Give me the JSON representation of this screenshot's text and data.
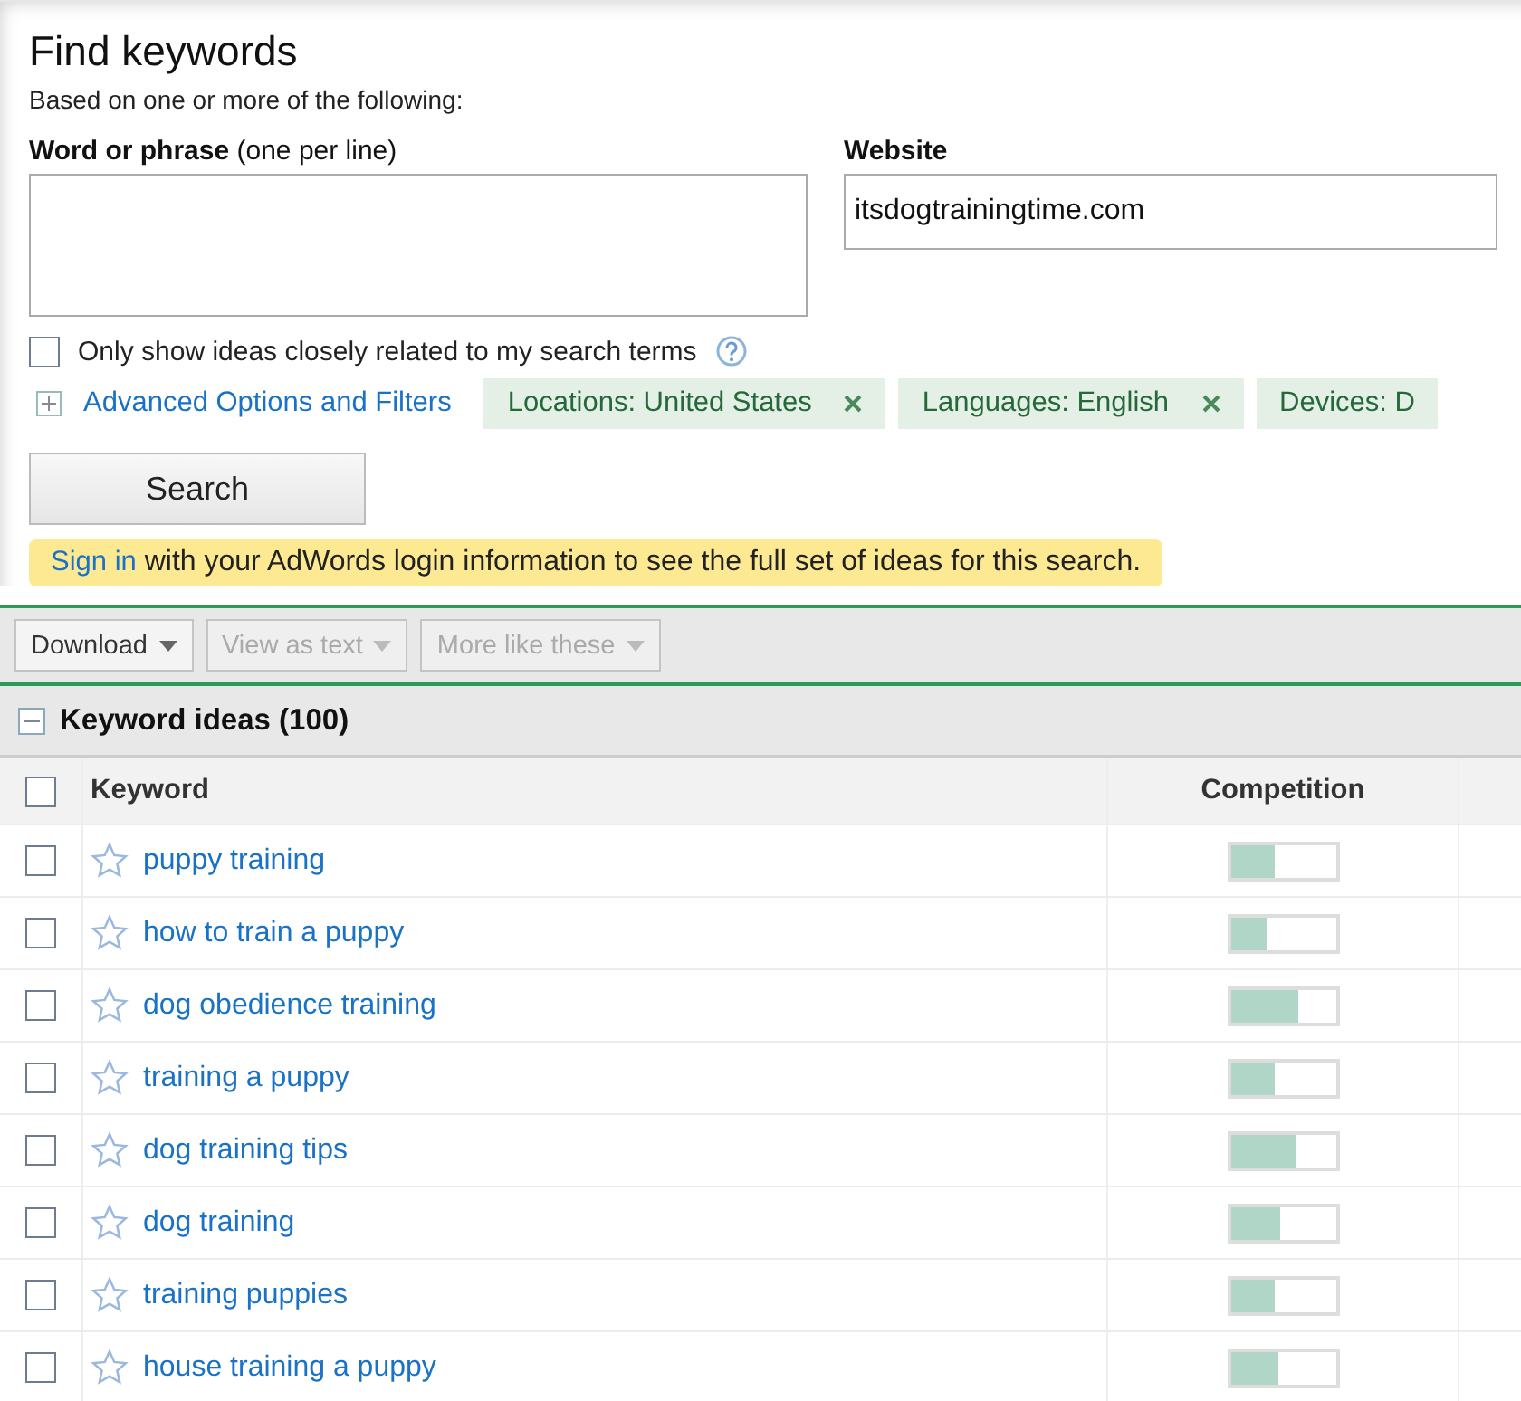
{
  "title": "Find keywords",
  "subtitle": "Based on one or more of the following:",
  "word_field": {
    "label": "Word or phrase",
    "hint": "(one per line)"
  },
  "website_field": {
    "label": "Website",
    "value": "itsdogtrainingtime.com"
  },
  "closely_related": {
    "label": "Only show ideas closely related to my search terms",
    "checked": false
  },
  "advanced_link": "Advanced Options and Filters",
  "filters": [
    {
      "label": "Locations: United States",
      "removable": true
    },
    {
      "label": "Languages: English",
      "removable": true
    },
    {
      "label": "Devices: D",
      "removable": false
    }
  ],
  "search_button": "Search",
  "notice": {
    "link": "Sign in",
    "text": " with your AdWords login information to see the full set of ideas for this search."
  },
  "toolbar": [
    {
      "label": "Download",
      "disabled": false
    },
    {
      "label": "View as text",
      "disabled": true
    },
    {
      "label": "More like these",
      "disabled": true
    }
  ],
  "section": {
    "title": "Keyword ideas (100)",
    "expanded": true
  },
  "table": {
    "columns": [
      "Keyword",
      "Competition"
    ],
    "all_checked": false,
    "rows": [
      {
        "keyword": "puppy training",
        "checked": false,
        "starred": false,
        "level": 0.42
      },
      {
        "keyword": "how to train a puppy",
        "checked": false,
        "starred": false,
        "level": 0.35
      },
      {
        "keyword": "dog obedience training",
        "checked": false,
        "starred": false,
        "level": 0.65
      },
      {
        "keyword": "training a puppy",
        "checked": false,
        "starred": false,
        "level": 0.42
      },
      {
        "keyword": "dog training tips",
        "checked": false,
        "starred": false,
        "level": 0.63
      },
      {
        "keyword": "dog training",
        "checked": false,
        "starred": false,
        "level": 0.47
      },
      {
        "keyword": "training puppies",
        "checked": false,
        "starred": false,
        "level": 0.42
      },
      {
        "keyword": "house training a puppy",
        "checked": false,
        "starred": false,
        "level": 0.45
      }
    ]
  }
}
